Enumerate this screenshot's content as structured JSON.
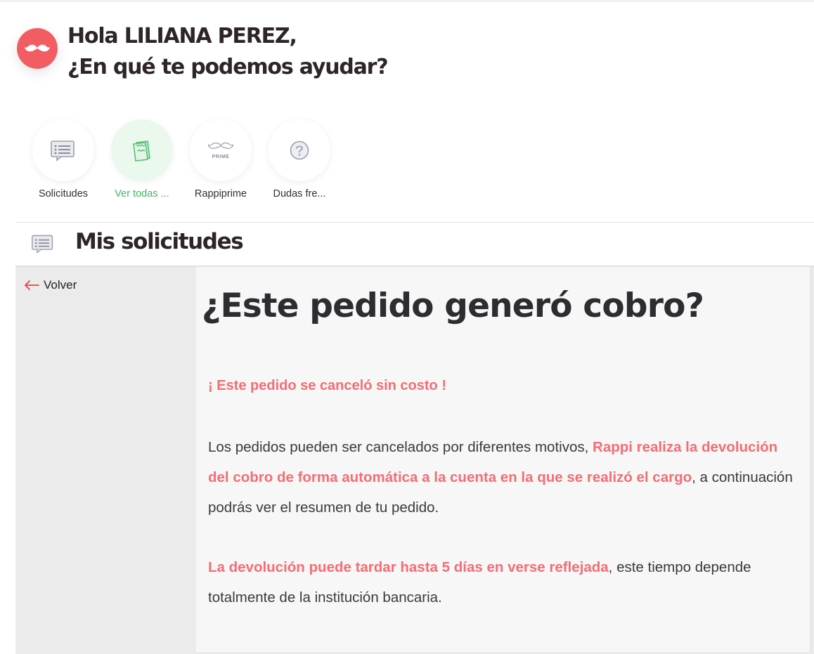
{
  "greeting": {
    "line1": "Hola LILIANA PEREZ,",
    "line2": "¿En qué te podemos ayudar?"
  },
  "shortcuts": [
    {
      "label": "Solicitudes",
      "icon": "chat-list-icon",
      "active": false
    },
    {
      "label": "Ver todas ...",
      "icon": "receipt-icon",
      "active": true
    },
    {
      "label": "Rappiprime",
      "icon": "prime-mustache-icon",
      "badge": "PRIME",
      "active": false
    },
    {
      "label": "Dudas fre...",
      "icon": "question-circle-icon",
      "active": false
    }
  ],
  "section": {
    "title": "Mis solicitudes",
    "icon": "chat-list-icon"
  },
  "nav": {
    "back_label": "Volver",
    "back_icon": "arrow-left-icon"
  },
  "article": {
    "title": "¿Este pedido generó cobro?",
    "highlight": "¡ Este pedido se canceló sin costo !",
    "p1_text1": "Los pedidos pueden ser cancelados por diferentes motivos, ",
    "p1_bold": "Rappi realiza la devolución del cobro de forma automática a la cuenta en la que se realizó el cargo",
    "p1_text2": ", a continuación podrás ver el resumen de tu pedido.",
    "p2_bold": " La devolución puede tardar hasta 5 días en verse reflejada",
    "p2_text": ", este tiempo depende totalmente de la institución bancaria."
  },
  "colors": {
    "brand_red": "#f25d63",
    "highlight": "#f46d74",
    "active_green": "#3fb65f"
  }
}
